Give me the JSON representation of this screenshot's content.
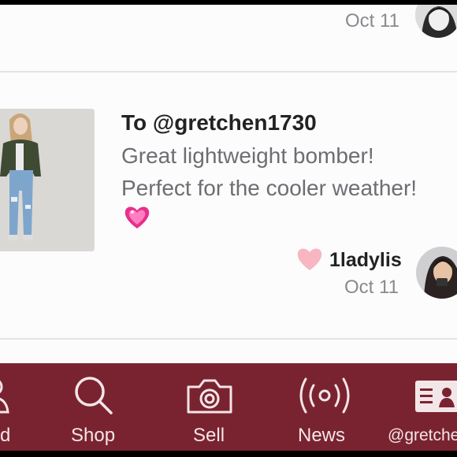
{
  "feed": {
    "prev_item": {
      "date": "Oct 11"
    },
    "item": {
      "recipient": "To @gretchen1730",
      "message_line1": "Great lightweight bomber!",
      "message_line2": "Perfect for the cooler weather!",
      "emoji": "pink-sparkling-heart",
      "username": "1ladylis",
      "date": "Oct 11"
    }
  },
  "tabbar": {
    "background": "#7a2330",
    "tabs": [
      {
        "label": "d",
        "icon": "person-icon"
      },
      {
        "label": "Shop",
        "icon": "search-icon"
      },
      {
        "label": "Sell",
        "icon": "camera-icon"
      },
      {
        "label": "News",
        "icon": "broadcast-icon"
      },
      {
        "label": "@gretchen",
        "icon": "profile-card-icon"
      }
    ]
  }
}
